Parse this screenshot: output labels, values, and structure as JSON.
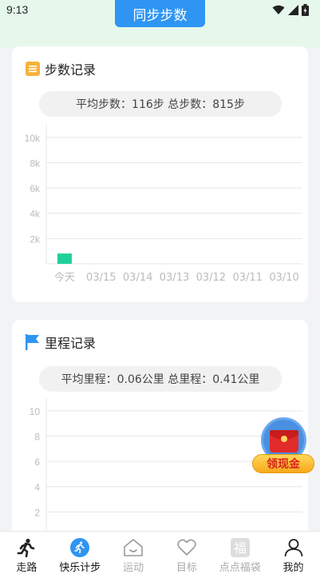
{
  "status": {
    "time": "9:13"
  },
  "sync_button": "同步步数",
  "steps_card": {
    "title": "步数记录",
    "summary": "平均步数：116步  总步数：815步"
  },
  "mileage_card": {
    "title": "里程记录",
    "summary": "平均里程：0.06公里  总里程：0.41公里"
  },
  "floating_reward": {
    "label": "领现金"
  },
  "nav": {
    "walk": "走路",
    "pedometer": "快乐计步",
    "sport": "运动",
    "goal": "目标",
    "lucky_bag": "点点福袋",
    "mine": "我的"
  },
  "colors": {
    "accent": "#2f95f3",
    "bar": "#1fd09a",
    "grid": "#e6e6e6"
  },
  "chart_data": [
    {
      "type": "bar",
      "title": "步数记录",
      "categories": [
        "今天",
        "03/15",
        "03/14",
        "03/13",
        "03/12",
        "03/11",
        "03/10"
      ],
      "values": [
        815,
        0,
        0,
        0,
        0,
        0,
        0
      ],
      "yticks": [
        "2k",
        "4k",
        "6k",
        "8k",
        "10k"
      ],
      "ylim": [
        0,
        11000
      ],
      "grid": true
    },
    {
      "type": "bar",
      "title": "里程记录",
      "yticks": [
        "2",
        "4",
        "6",
        "8",
        "10"
      ],
      "ylim": [
        0,
        11
      ],
      "grid": true
    }
  ]
}
